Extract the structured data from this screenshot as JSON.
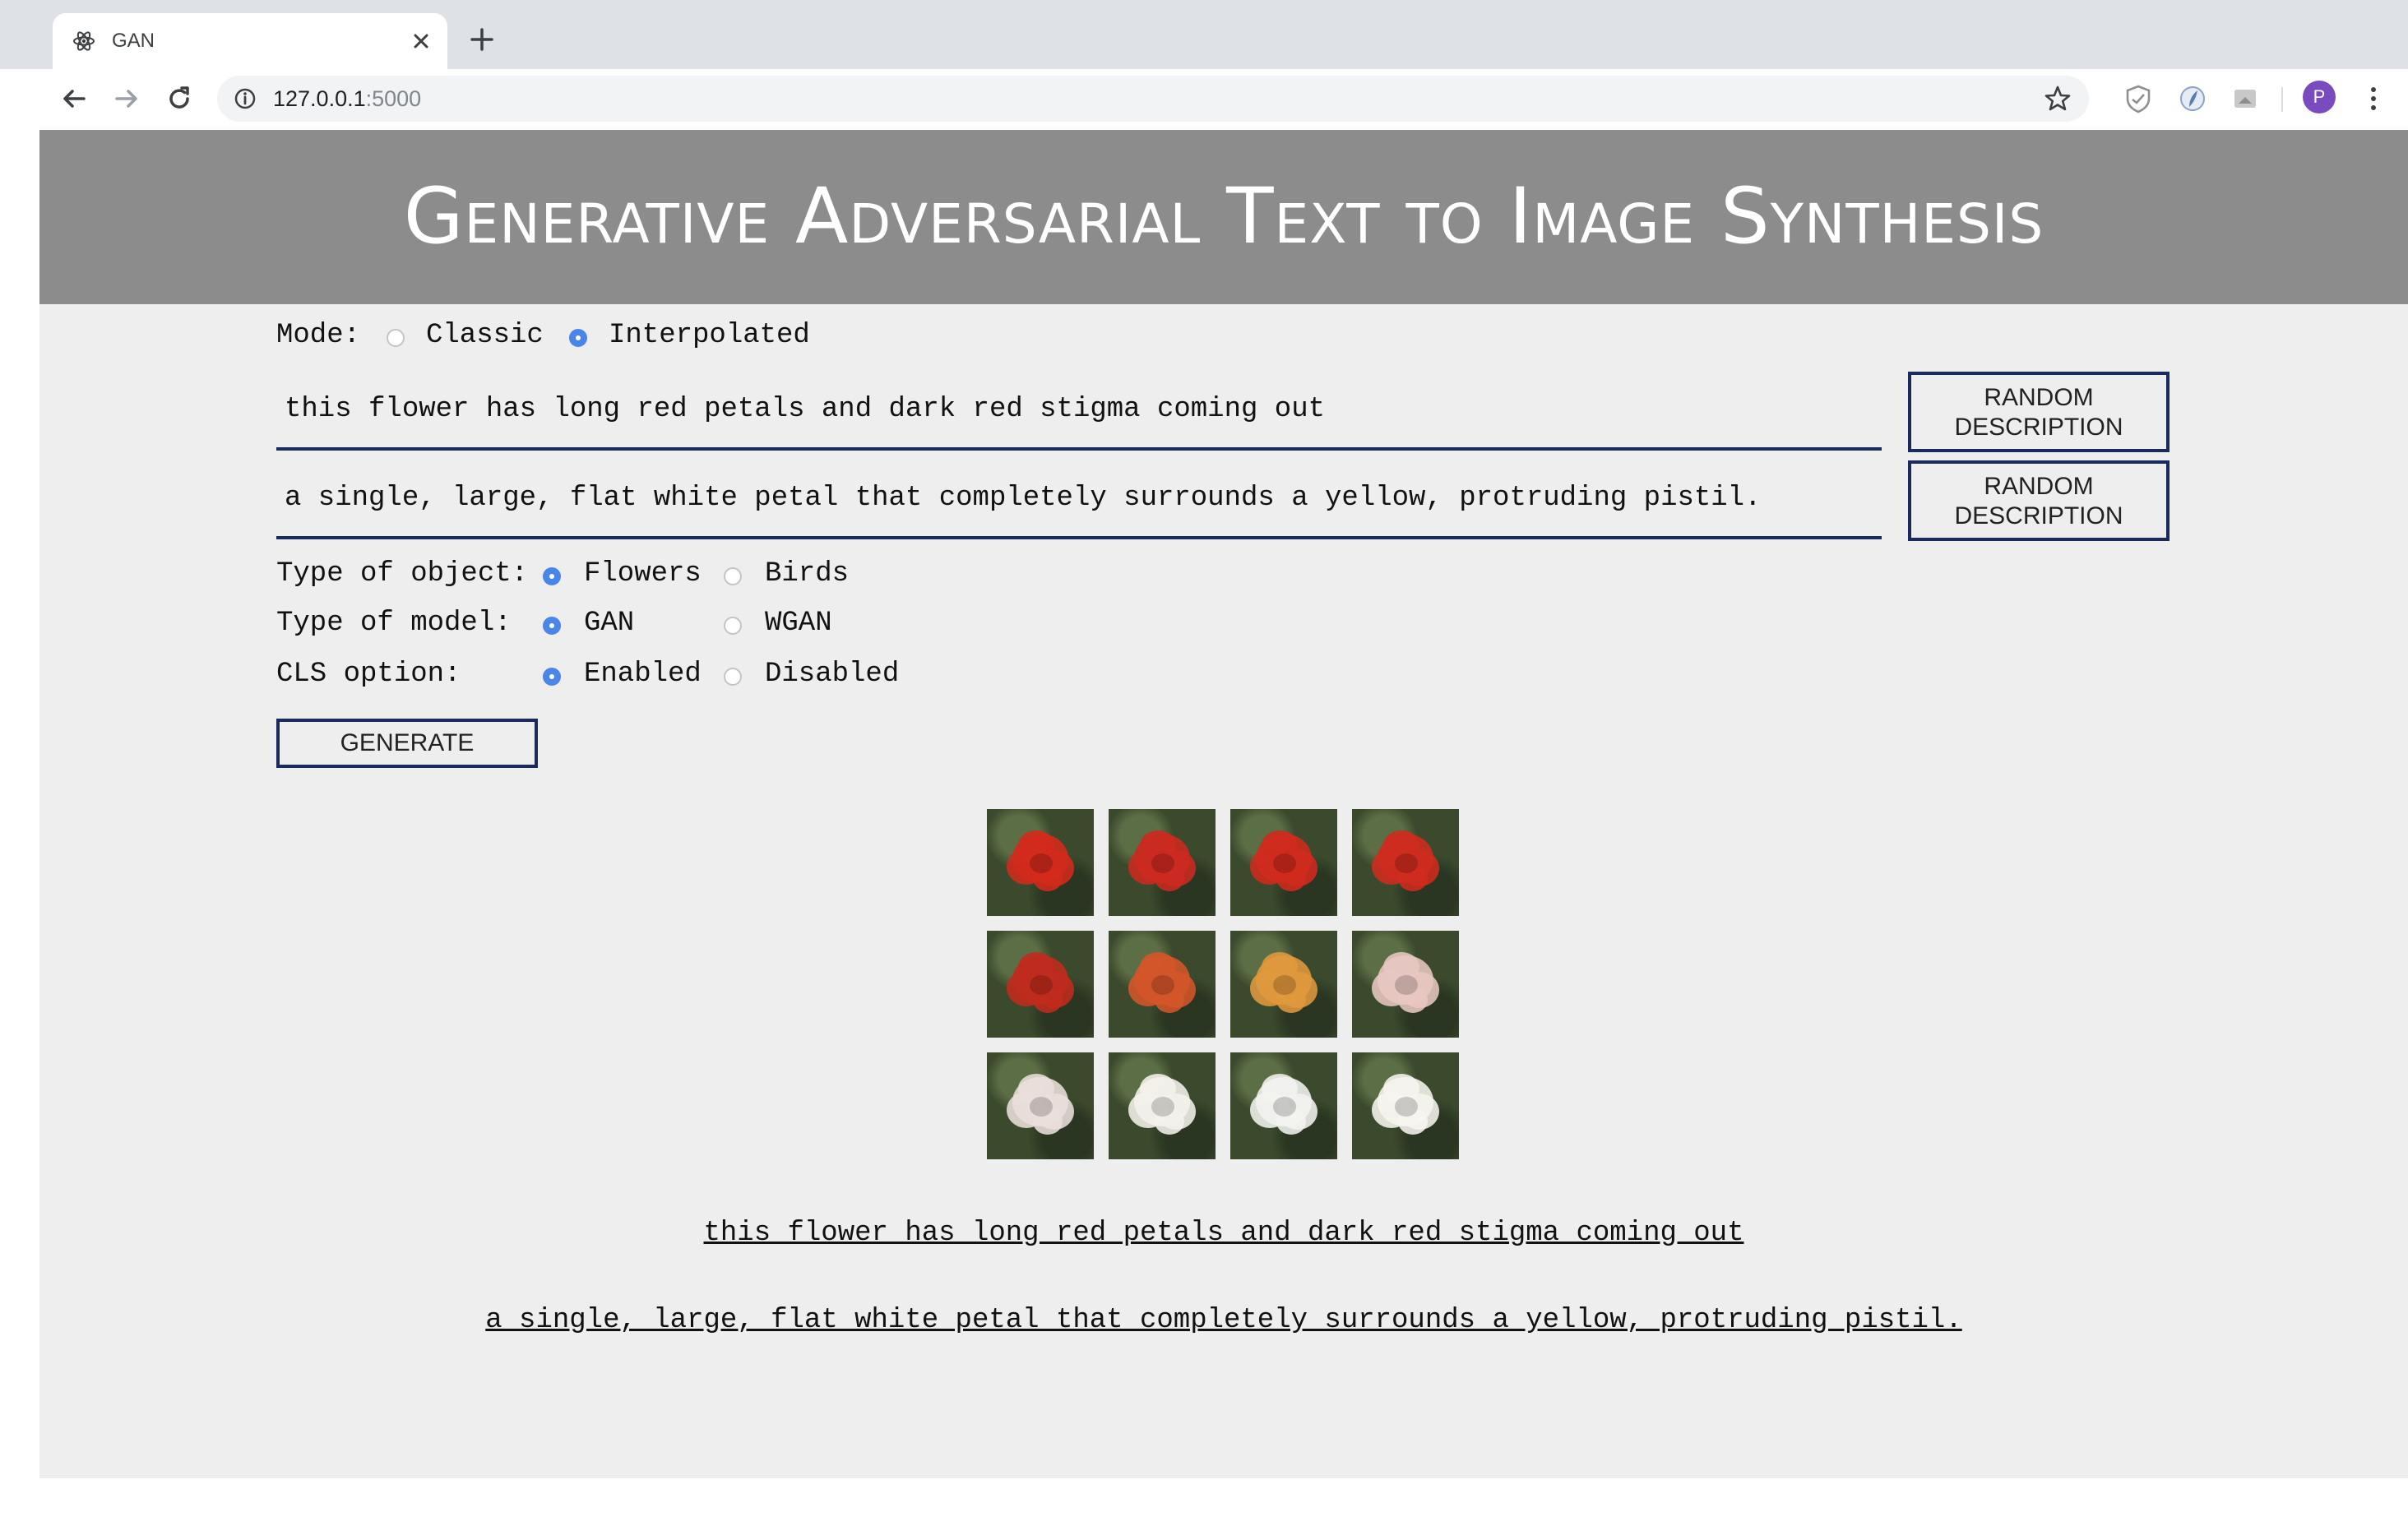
{
  "browser": {
    "tab_title": "GAN",
    "url_host": "127.0.0.1",
    "url_port": ":5000",
    "avatar_letter": "P"
  },
  "header": {
    "title": "Generative Adversarial Text to Image Synthesis"
  },
  "mode": {
    "label": "Mode:",
    "options": [
      "Classic",
      "Interpolated"
    ],
    "selected": "Interpolated"
  },
  "descriptions": {
    "first": "this flower has long red petals and dark red stigma coming out",
    "second": "a single, large, flat white petal that completely surrounds a yellow, protruding pistil.",
    "random_button_label_1": "RANDOM DESCRIPTION",
    "random_button_label_2": "RANDOM DESCRIPTION"
  },
  "options": {
    "object": {
      "label": "Type of object:",
      "options": [
        "Flowers",
        "Birds"
      ],
      "selected": "Flowers"
    },
    "model": {
      "label": "Type of model:",
      "options": [
        "GAN",
        "WGAN"
      ],
      "selected": "GAN"
    },
    "cls": {
      "label": "CLS option:",
      "options": [
        "Enabled",
        "Disabled"
      ],
      "selected": "Enabled"
    }
  },
  "generate_label": "GENERATE",
  "results": {
    "captions": [
      "this flower has long red petals and dark red stigma coming out",
      "a single, large, flat white petal that completely surrounds a yellow, protruding pistil."
    ],
    "image_colors": [
      "#d32a1c",
      "#cc2a20",
      "#d02a1e",
      "#cf2b1f",
      "#c02b1e",
      "#d4552a",
      "#e0983e",
      "#e8c7c2",
      "#ebdfdc",
      "#f4f1ec",
      "#f2f3f0",
      "#f6f5ef"
    ],
    "background_color": "#3b4a2d"
  },
  "colors": {
    "header_bg": "#8c8c8c",
    "page_bg": "#eeeeef",
    "accent": "#1b2a5c",
    "radio_selected": "#4a86e8"
  }
}
